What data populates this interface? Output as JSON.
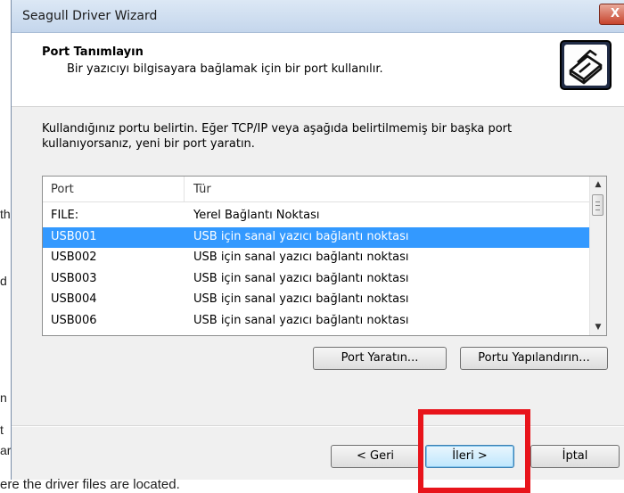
{
  "window": {
    "title": "Seagull Driver Wizard",
    "close_label": "X"
  },
  "header": {
    "title": "Port Tanımlayın",
    "subtitle": "Bir yazıcıyı bilgisayara bağlamak için bir port kullanılır.",
    "icon": "printer-wizard-icon"
  },
  "instructions": "Kullandığınız portu belirtin. Eğer TCP/IP veya aşağıda belirtilmemiş bir başka port kullanıyorsanız, yeni bir port yaratın.",
  "port_list": {
    "columns": [
      "Port",
      "Tür"
    ],
    "rows": [
      {
        "port": "FILE:",
        "type": "Yerel Bağlantı Noktası"
      },
      {
        "port": "USB001",
        "type": "USB için sanal yazıcı bağlantı noktası"
      },
      {
        "port": "USB002",
        "type": "USB için sanal yazıcı bağlantı noktası"
      },
      {
        "port": "USB003",
        "type": "USB için sanal yazıcı bağlantı noktası"
      },
      {
        "port": "USB004",
        "type": "USB için sanal yazıcı bağlantı noktası"
      },
      {
        "port": "USB006",
        "type": "USB için sanal yazıcı bağlantı noktası"
      }
    ],
    "selected_row": 1
  },
  "buttons": {
    "create_port": "Port Yaratın...",
    "configure_port": "Portu Yapılandırın...",
    "back": "< Geri",
    "next": "İleri >",
    "cancel": "İptal"
  },
  "background": {
    "fragments": [
      "th",
      "d",
      "n",
      "t",
      "ar"
    ],
    "bottom_line": "ere the driver files are located."
  },
  "colors": {
    "selection": "#3399ff",
    "highlight_box": "#e8141b"
  }
}
